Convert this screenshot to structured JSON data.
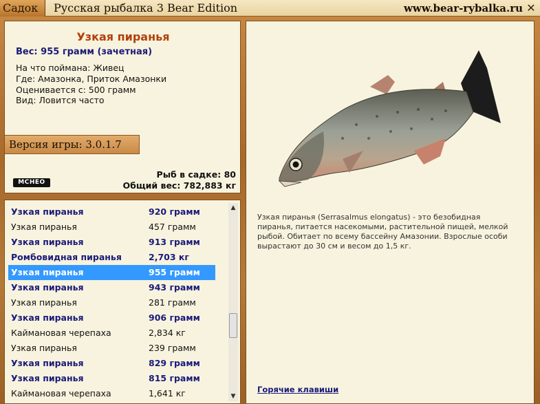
{
  "titlebar": {
    "tab_label": "Садок",
    "app_title": "Русская рыбалка 3 Bear Edition",
    "site_url": "www.bear-rybalka.ru",
    "close_glyph": "✕"
  },
  "info": {
    "fish_name": "Узкая пиранья",
    "weight": "Вес: 955 грамм (зачетная)",
    "caught_on": "На что поймана: Живец",
    "location": "Где: Амазонка, Приток Амазонки",
    "rated_from": "Оценивается с: 500 грамм",
    "catch_rate": "Вид: Ловится часто",
    "version": "Версия игры: 3.0.1.7",
    "logo_text": "МСНЕО",
    "fish_count": "Рыб в садке: 80",
    "total_weight": "Общий вес: 782,883 кг"
  },
  "list": {
    "rows": [
      {
        "name": "Узкая пиранья",
        "weight": "920 грамм",
        "style": "bold"
      },
      {
        "name": "Узкая пиранья",
        "weight": "457 грамм",
        "style": "plain"
      },
      {
        "name": "Узкая пиранья",
        "weight": "913 грамм",
        "style": "bold"
      },
      {
        "name": "Ромбовидная пиранья",
        "weight": "2,703 кг",
        "style": "bold"
      },
      {
        "name": "Узкая пиранья",
        "weight": "955 грамм",
        "style": "selected"
      },
      {
        "name": "Узкая пиранья",
        "weight": "943 грамм",
        "style": "bold"
      },
      {
        "name": "Узкая пиранья",
        "weight": "281 грамм",
        "style": "plain"
      },
      {
        "name": "Узкая пиранья",
        "weight": "906 грамм",
        "style": "bold"
      },
      {
        "name": "Каймановая черепаха",
        "weight": "2,834 кг",
        "style": "plain"
      },
      {
        "name": "Узкая пиранья",
        "weight": "239 грамм",
        "style": "plain"
      },
      {
        "name": "Узкая пиранья",
        "weight": "829 грамм",
        "style": "bold"
      },
      {
        "name": "Узкая пиранья",
        "weight": "815 грамм",
        "style": "bold"
      },
      {
        "name": "Каймановая черепаха",
        "weight": "1,641 кг",
        "style": "plain"
      }
    ]
  },
  "details": {
    "description": "Узкая пиранья (Serrasalmus elongatus) - это безобидная пиранья, питается насекомыми, растительной пищей, мелкой рыбой. Обитает по всему бассейну Амазонии. Взрослые особи вырастают до 30 см и весом до 1,5 кг.",
    "hotkeys_label": "Горячие клавиши"
  },
  "colors": {
    "accent_title": "#b2410a",
    "bold_row": "#1a1a7a",
    "selected_row": "#3399ff",
    "panel_bg": "#f8f3de"
  }
}
